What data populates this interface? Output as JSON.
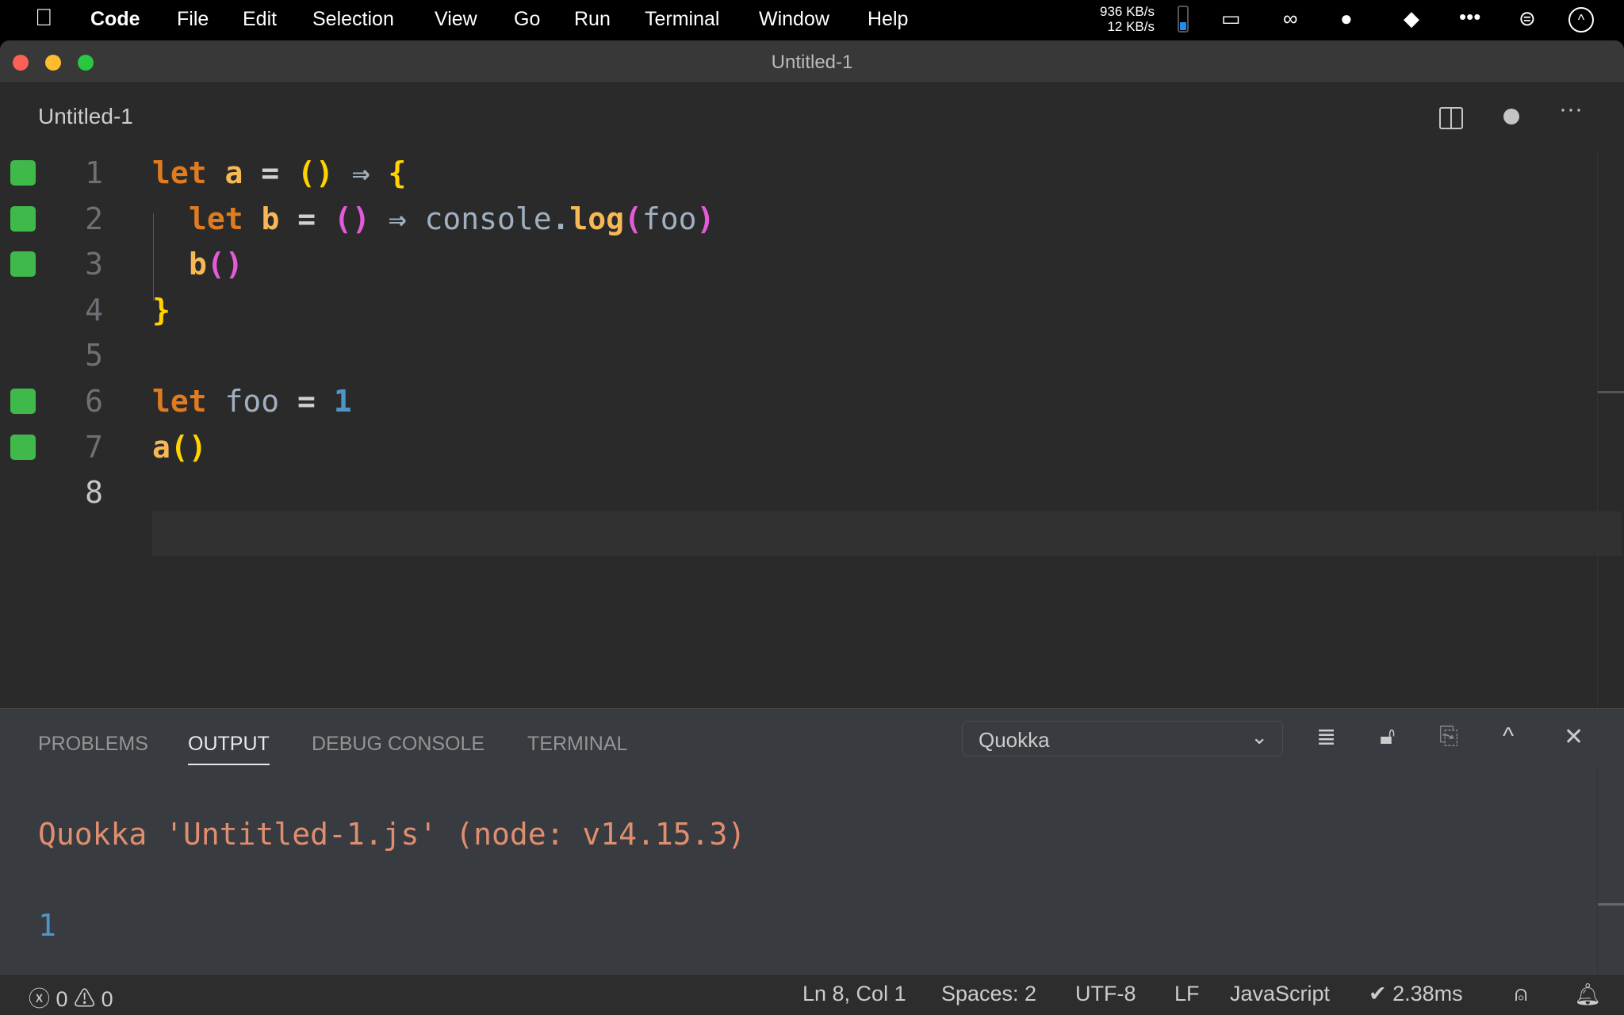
{
  "menubar": {
    "app": "Code",
    "items": [
      "File",
      "Edit",
      "Selection",
      "View",
      "Go",
      "Run",
      "Terminal",
      "Window",
      "Help"
    ],
    "net_down": "936 KB/s",
    "net_up": "12 KB/s",
    "tray_icons": [
      "battery-level-icon",
      "battery-charging-icon",
      "link-icon",
      "wechat-icon",
      "app-cube-icon",
      "more-icon",
      "control-center-icon",
      "chevron-up-circle-icon"
    ]
  },
  "window": {
    "title": "Untitled-1"
  },
  "tab": {
    "name": "Untitled-1"
  },
  "editor": {
    "lines": [
      {
        "n": "1",
        "covered": true
      },
      {
        "n": "2",
        "covered": true
      },
      {
        "n": "3",
        "covered": true
      },
      {
        "n": "4",
        "covered": false
      },
      {
        "n": "5",
        "covered": false
      },
      {
        "n": "6",
        "covered": true
      },
      {
        "n": "7",
        "covered": true
      },
      {
        "n": "8",
        "covered": false
      }
    ],
    "code": {
      "l1": [
        "let",
        " a",
        " =",
        " ()",
        " ⇒",
        " {"
      ],
      "l2": [
        "let",
        " b",
        " =",
        " ()",
        " ⇒",
        " console",
        ".",
        " log",
        "(",
        "foo",
        ")"
      ],
      "l3": [
        "b",
        "()"
      ],
      "l4": [
        "}"
      ],
      "l6": [
        "let",
        " foo",
        " =",
        " 1"
      ],
      "l7": [
        "a",
        "()"
      ]
    },
    "colors": {
      "gutter_covered": "#3fb94a",
      "keyword": "#e07b20",
      "identifier": "#f7b955",
      "paren_level1": "#ffd200",
      "paren_level2": "#e45ad9",
      "number": "#4f96c8"
    }
  },
  "panel": {
    "tabs": [
      "PROBLEMS",
      "OUTPUT",
      "DEBUG CONSOLE",
      "TERMINAL"
    ],
    "active_tab": "OUTPUT",
    "channel": "Quokka",
    "output": [
      "Quokka 'Untitled-1.js' (node: v14.15.3)",
      "1"
    ]
  },
  "status": {
    "errors": "0",
    "warnings": "0",
    "position": "Ln 8, Col 1",
    "spaces": "Spaces: 2",
    "encoding": "UTF-8",
    "eol": "LF",
    "language": "JavaScript",
    "quokka": "✔ 2.38ms"
  }
}
